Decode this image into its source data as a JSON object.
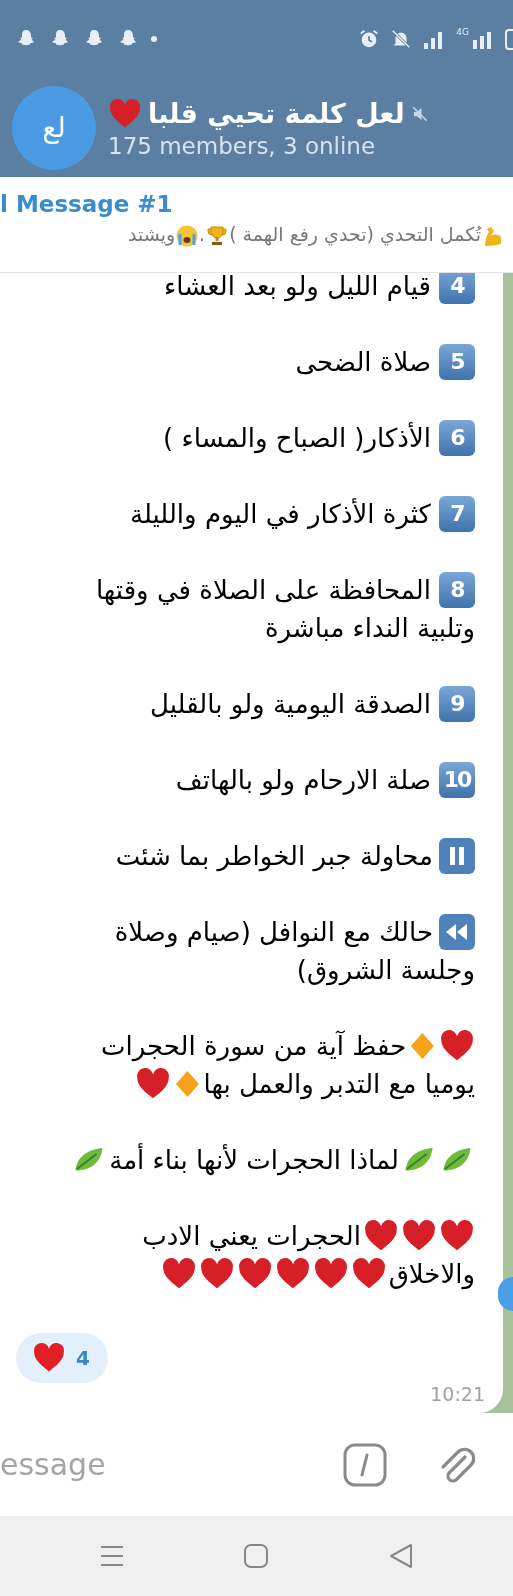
{
  "status_bar": {
    "network": "4G"
  },
  "header": {
    "avatar_initials": "لع",
    "muted": true,
    "title": [
      {
        "kind": "text",
        "text": "لعل كلمة تحيي قلبا"
      },
      {
        "kind": "heart"
      }
    ],
    "subtitle": "175 members, 3 online"
  },
  "pinned": {
    "label": "l Message #1",
    "parts": [
      {
        "kind": "muscle"
      },
      {
        "kind": "text",
        "text": "تُكمل التحدي (تحدي رفع الهمة )"
      },
      {
        "kind": "trophy"
      },
      {
        "kind": "text",
        "text": "."
      },
      {
        "kind": "crying"
      },
      {
        "kind": "text",
        "text": "ويشتد"
      }
    ]
  },
  "message": {
    "paragraphs": [
      {
        "parts": [
          {
            "kind": "keycap",
            "text": "4"
          },
          {
            "kind": "text",
            "text": "قيام الليل ولو  بعد العشاء"
          }
        ]
      },
      {
        "parts": [
          {
            "kind": "keycap",
            "text": "5"
          },
          {
            "kind": "text",
            "text": "صلاة الضحى"
          }
        ]
      },
      {
        "parts": [
          {
            "kind": "keycap",
            "text": "6"
          },
          {
            "kind": "text",
            "text": "الأذكار( الصباح والمساء )"
          }
        ]
      },
      {
        "parts": [
          {
            "kind": "keycap",
            "text": "7"
          },
          {
            "kind": "text",
            "text": "كثرة الأذكار في اليوم والليلة"
          }
        ]
      },
      {
        "parts": [
          {
            "kind": "keycap",
            "text": "8"
          },
          {
            "kind": "text",
            "text": "المحافظة على الصلاة في وقتها"
          }
        ],
        "more_lines": [
          [
            {
              "kind": "text",
              "text": "وتلبية النداء مباشرة"
            }
          ]
        ]
      },
      {
        "parts": [
          {
            "kind": "keycap",
            "text": "9"
          },
          {
            "kind": "text",
            "text": "الصدقة اليومية ولو بالقليل"
          }
        ]
      },
      {
        "parts": [
          {
            "kind": "keycap",
            "text": "10"
          },
          {
            "kind": "text",
            "text": "صلة الارحام ولو بالهاتف"
          }
        ]
      },
      {
        "parts": [
          {
            "kind": "pause"
          },
          {
            "kind": "text",
            "text": "محاولة جبر الخواطر بما شئت"
          }
        ]
      },
      {
        "parts": [
          {
            "kind": "rewind"
          },
          {
            "kind": "text",
            "text": "حالك مع النوافل (صيام وصلاة"
          }
        ],
        "more_lines": [
          [
            {
              "kind": "text",
              "text": "وجلسة الشروق)"
            }
          ]
        ]
      },
      {
        "parts": [
          {
            "kind": "heart"
          },
          {
            "kind": "diamond"
          },
          {
            "kind": "text",
            "text": "حفظ آية من سورة الحجرات"
          }
        ],
        "more_lines": [
          [
            {
              "kind": "text",
              "text": "يوميا مع التدبر والعمل بها"
            },
            {
              "kind": "diamond"
            },
            {
              "kind": "heart"
            }
          ]
        ]
      },
      {
        "parts": [
          {
            "kind": "leaf"
          },
          {
            "kind": "leaf"
          },
          {
            "kind": "text",
            "text": "لماذا الحجرات لأنها بناء أمة"
          },
          {
            "kind": "leaf"
          }
        ]
      },
      {
        "parts": [
          {
            "kind": "heart"
          },
          {
            "kind": "heart"
          },
          {
            "kind": "heart"
          },
          {
            "kind": "text",
            "text": "الحجرات يعني الادب"
          }
        ],
        "more_lines": [
          [
            {
              "kind": "text",
              "text": "والاخلاق"
            },
            {
              "kind": "heart"
            },
            {
              "kind": "heart"
            },
            {
              "kind": "heart"
            },
            {
              "kind": "heart"
            },
            {
              "kind": "heart"
            },
            {
              "kind": "heart"
            }
          ]
        ]
      }
    ],
    "reaction": {
      "count": "4"
    },
    "time": "10:21"
  },
  "composer": {
    "placeholder": "essage"
  }
}
